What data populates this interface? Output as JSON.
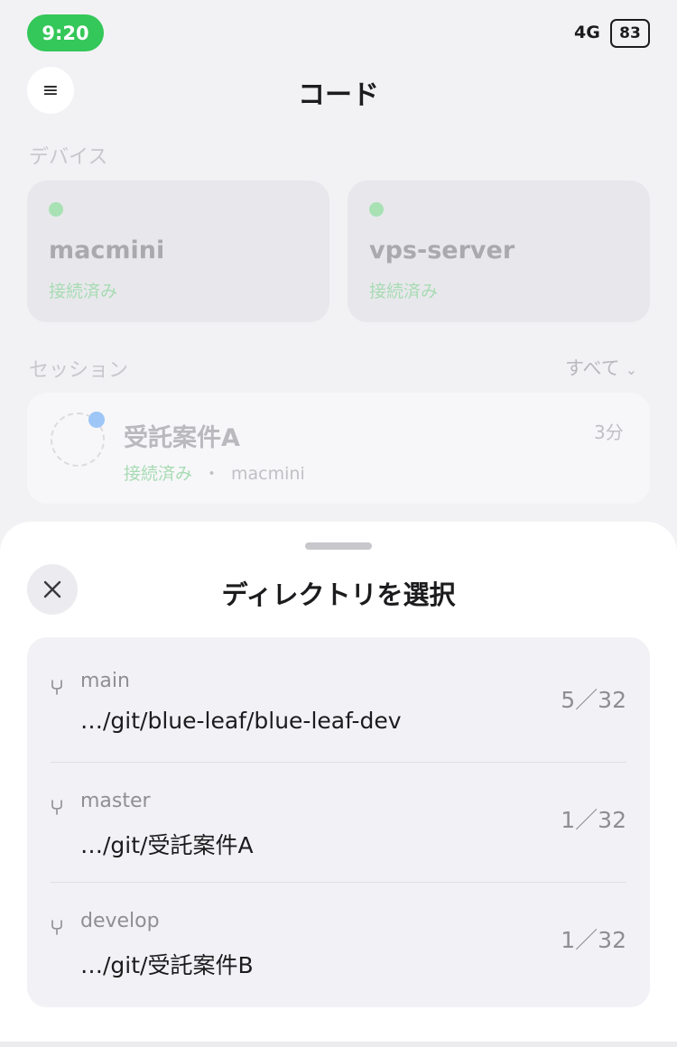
{
  "status_bar": {
    "time": "9:20",
    "signal": "4G",
    "battery": "83"
  },
  "header": {
    "title": "コード",
    "menu_icon": "≡"
  },
  "devices": {
    "label": "デバイス",
    "items": [
      {
        "name": "macmini",
        "status": "接続済み"
      },
      {
        "name": "vps-server",
        "status": "接続済み"
      }
    ]
  },
  "sessions": {
    "label": "セッション",
    "filter": "すべて",
    "filter_icon": "⌄",
    "items": [
      {
        "name": "受託案件A",
        "status": "接続済み",
        "separator": "・",
        "device": "macmini",
        "time": "3分"
      }
    ]
  },
  "sheet": {
    "title": "ディレクトリを選択",
    "directories": [
      {
        "branch": "main",
        "path": "…/git/blue-leaf/blue-leaf-dev",
        "count": "5／32"
      },
      {
        "branch": "master",
        "path": "…/git/受託案件A",
        "count": "1／32"
      },
      {
        "branch": "develop",
        "path": "…/git/受託案件B",
        "count": "1／32"
      }
    ]
  },
  "colors": {
    "status_green": "#34c759",
    "online_dot": "#a7e1b4",
    "session_dot": "#9ec6f6",
    "sheet_bg": "#ffffff",
    "list_bg": "#f2f2f6"
  }
}
